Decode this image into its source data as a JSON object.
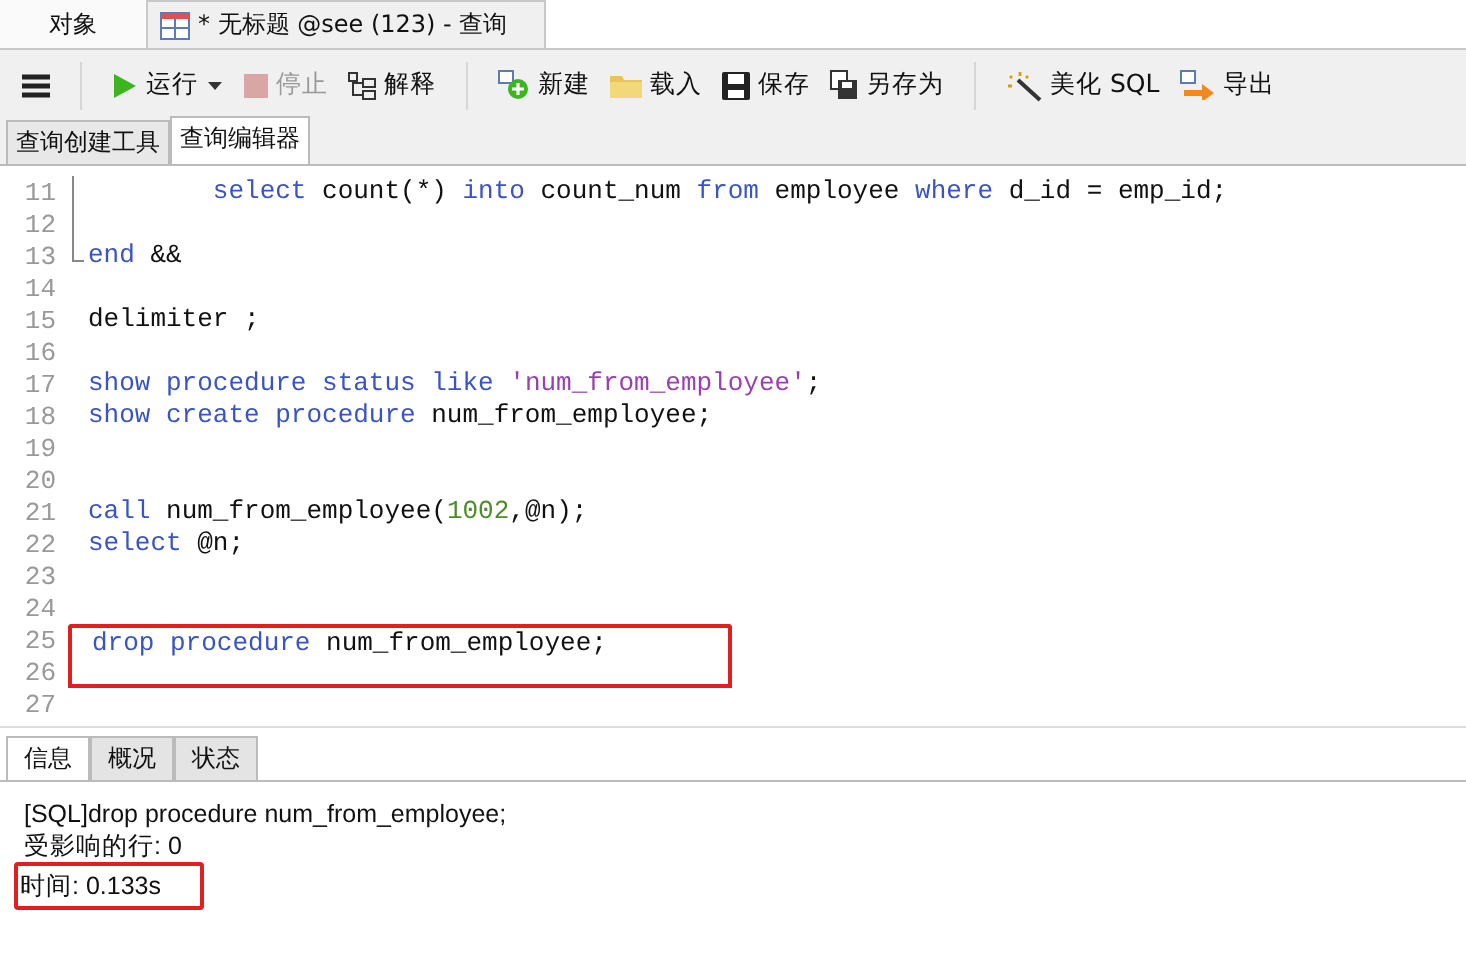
{
  "window_tabs": [
    {
      "label": "对象",
      "selected": false,
      "icon": false
    },
    {
      "label": "* 无标题 @see (123) - 查询",
      "selected": true,
      "icon": true
    }
  ],
  "toolbar": [
    {
      "kind": "menu",
      "disabled": false
    },
    {
      "kind": "sep"
    },
    {
      "kind": "run",
      "label": "运行",
      "disabled": false
    },
    {
      "kind": "stop",
      "label": "停止",
      "disabled": true
    },
    {
      "kind": "explain",
      "label": "解释",
      "disabled": false
    },
    {
      "kind": "sep"
    },
    {
      "kind": "new",
      "label": "新建",
      "disabled": false
    },
    {
      "kind": "load",
      "label": "载入",
      "disabled": false
    },
    {
      "kind": "save",
      "label": "保存",
      "disabled": false
    },
    {
      "kind": "saveas",
      "label": "另存为",
      "disabled": false
    },
    {
      "kind": "sep"
    },
    {
      "kind": "beautify",
      "label": "美化 SQL",
      "disabled": false
    },
    {
      "kind": "export",
      "label": "导出",
      "disabled": false
    }
  ],
  "sub_tabs": [
    {
      "label": "查询创建工具",
      "selected": false
    },
    {
      "label": "查询编辑器",
      "selected": true
    }
  ],
  "editor": {
    "lines": [
      {
        "number": "11",
        "kind": "fold_body",
        "boxed": false,
        "tokens": [
          {
            "kind": "kw",
            "text": "        select"
          },
          {
            "kind": "plain",
            "text": " count(*) "
          },
          {
            "kind": "kw",
            "text": "into"
          },
          {
            "kind": "plain",
            "text": " count_num "
          },
          {
            "kind": "kw",
            "text": "from"
          },
          {
            "kind": "plain",
            "text": " employee "
          },
          {
            "kind": "kw",
            "text": "where"
          },
          {
            "kind": "plain",
            "text": " d_id = emp_id;"
          }
        ]
      },
      {
        "number": "12",
        "kind": "fold_body",
        "boxed": false
      },
      {
        "number": "13",
        "kind": "fold_end",
        "boxed": false,
        "tokens": [
          {
            "kind": "kw",
            "text": "end"
          },
          {
            "kind": "plain",
            "text": " &&"
          }
        ]
      },
      {
        "number": "14",
        "kind": "plain",
        "boxed": false
      },
      {
        "number": "15",
        "kind": "plain",
        "boxed": false,
        "tokens": [
          {
            "kind": "plain",
            "text": "delimiter ;"
          }
        ]
      },
      {
        "number": "16",
        "kind": "plain",
        "boxed": false
      },
      {
        "number": "17",
        "kind": "plain",
        "boxed": false,
        "tokens": [
          {
            "kind": "kw",
            "text": "show procedure status like"
          },
          {
            "kind": "str",
            "text": " 'num_from_employee'"
          },
          {
            "kind": "plain",
            "text": ";"
          }
        ]
      },
      {
        "number": "18",
        "kind": "plain",
        "boxed": false,
        "tokens": [
          {
            "kind": "kw",
            "text": "show create procedure"
          },
          {
            "kind": "plain",
            "text": " num_from_employee;"
          }
        ]
      },
      {
        "number": "19",
        "kind": "plain",
        "boxed": false
      },
      {
        "number": "20",
        "kind": "plain",
        "boxed": false
      },
      {
        "number": "21",
        "kind": "plain",
        "boxed": false,
        "tokens": [
          {
            "kind": "kw",
            "text": "call"
          },
          {
            "kind": "plain",
            "text": " num_from_employee("
          },
          {
            "kind": "num",
            "text": "1002"
          },
          {
            "kind": "plain",
            "text": ",@n);"
          }
        ]
      },
      {
        "number": "22",
        "kind": "plain",
        "boxed": false,
        "tokens": [
          {
            "kind": "kw",
            "text": "select"
          },
          {
            "kind": "plain",
            "text": " @n;"
          }
        ]
      },
      {
        "number": "23",
        "kind": "plain",
        "boxed": false
      },
      {
        "number": "24",
        "kind": "plain",
        "boxed": false
      },
      {
        "number": "25",
        "kind": "plain",
        "boxed": true,
        "tokens": [
          {
            "kind": "kw",
            "text": "drop procedure"
          },
          {
            "kind": "plain",
            "text": " num_from_employee;"
          }
        ]
      },
      {
        "number": "26",
        "kind": "plain",
        "boxed": true
      },
      {
        "number": "27",
        "kind": "plain",
        "boxed": false
      }
    ]
  },
  "result_tabs": [
    {
      "label": "信息",
      "selected": true
    },
    {
      "label": "概况",
      "selected": false
    },
    {
      "label": "状态",
      "selected": false
    }
  ],
  "messages": [
    {
      "text": "[SQL]drop procedure num_from_employee;",
      "boxed": false
    },
    {
      "text": "受影响的行: 0",
      "boxed": false
    },
    {
      "text": "时间: 0.133s",
      "boxed": true
    }
  ]
}
